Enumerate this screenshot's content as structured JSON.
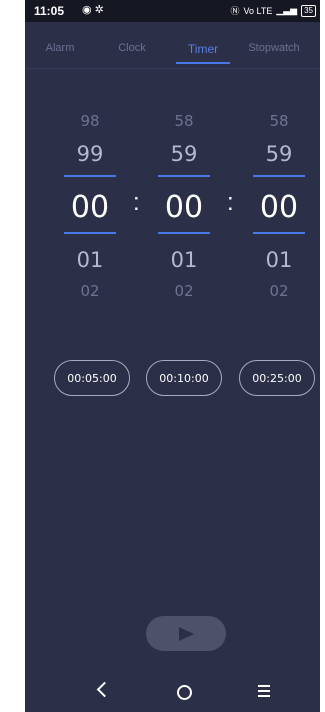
{
  "status_bar": {
    "time": "11:05",
    "left_icons": [
      "alarm-clock-icon",
      "settings-gear-icon"
    ],
    "right_icons": [
      "nfc-icon",
      "volte-icon",
      "signal-icon"
    ],
    "volte_label": "Vo LTE",
    "battery": "35"
  },
  "tabs": [
    {
      "label": "Alarm",
      "active": false
    },
    {
      "label": "Clock",
      "active": false
    },
    {
      "label": "Timer",
      "active": true
    },
    {
      "label": "Stopwatch",
      "active": false
    }
  ],
  "picker": {
    "hours": {
      "far_above": "98",
      "above": "99",
      "selected": "00",
      "below": "01",
      "far_below": "02"
    },
    "minutes": {
      "far_above": "58",
      "above": "59",
      "selected": "00",
      "below": "01",
      "far_below": "02"
    },
    "seconds": {
      "far_above": "58",
      "above": "59",
      "selected": "00",
      "below": "01",
      "far_below": "02"
    },
    "separator": ":"
  },
  "presets": [
    "00:05:00",
    "00:10:00",
    "00:25:00"
  ],
  "start_button": {
    "icon": "play-icon"
  },
  "nav_bar": {
    "icons": [
      "back-icon",
      "home-icon",
      "menu-icon"
    ]
  },
  "colors": {
    "background": "#2b2f48",
    "accent": "#4a78e6",
    "status_bar": "#151722"
  }
}
